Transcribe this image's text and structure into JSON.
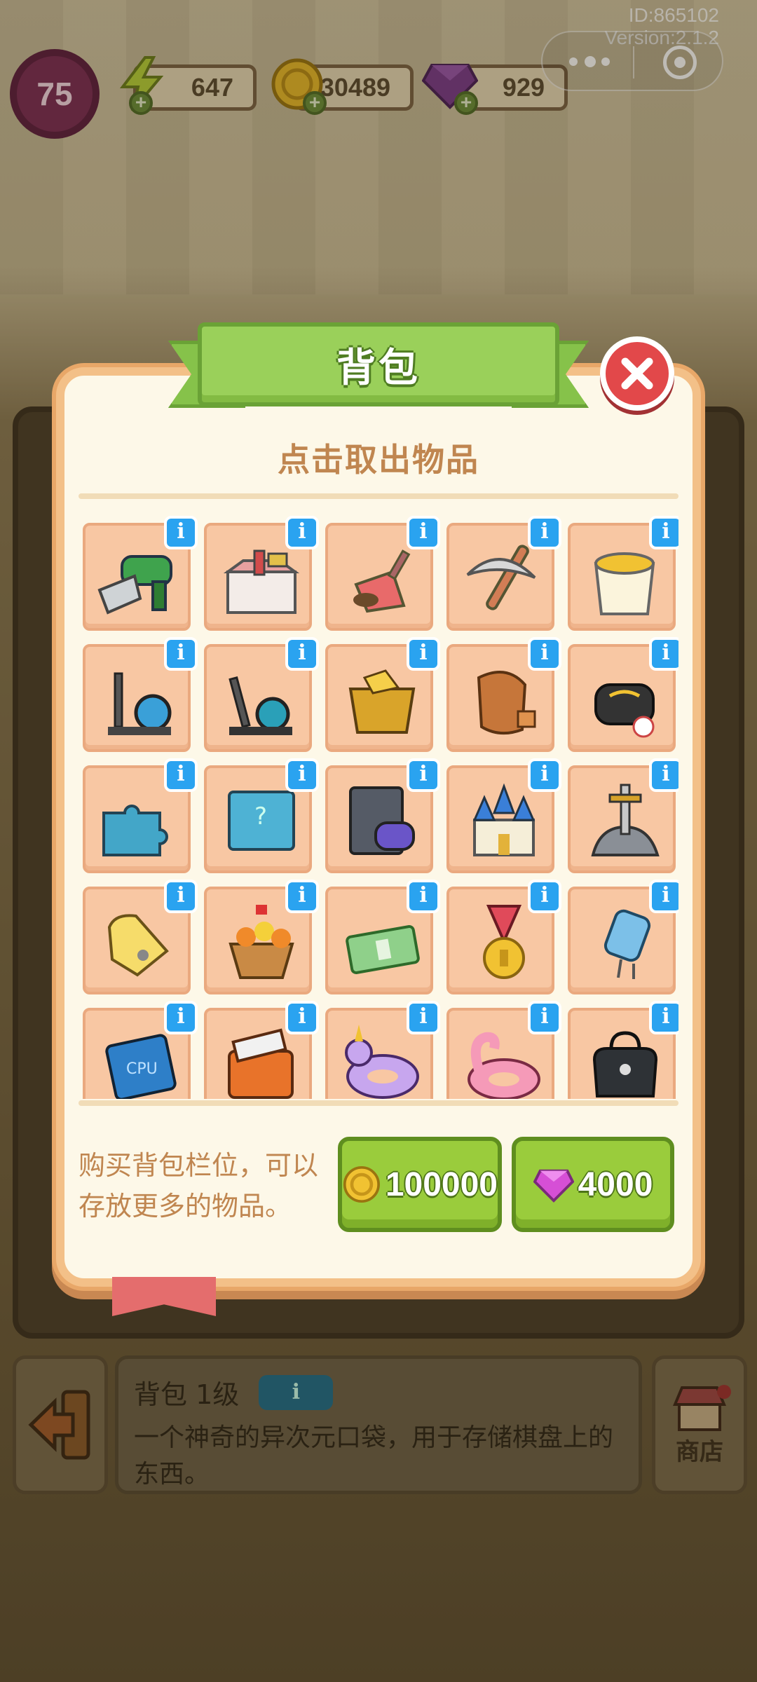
{
  "system": {
    "id_text": "ID:865102",
    "version_text": "Version:2.1.2"
  },
  "hud": {
    "level": "75",
    "energy": "647",
    "coins": "30489",
    "gems": "929"
  },
  "modal": {
    "title": "背包",
    "subtitle": "点击取出物品",
    "items": [
      {
        "name": "saw-drill-icon"
      },
      {
        "name": "toolbox-icon"
      },
      {
        "name": "trowel-icon"
      },
      {
        "name": "pickaxe-icon"
      },
      {
        "name": "paint-bucket-icon"
      },
      {
        "name": "elliptical-machine-icon"
      },
      {
        "name": "exercise-bike-icon"
      },
      {
        "name": "gold-ore-crate-icon"
      },
      {
        "name": "copper-ore-icon"
      },
      {
        "name": "smart-watch-icon"
      },
      {
        "name": "puzzle-pieces-icon"
      },
      {
        "name": "puzzle-board-icon"
      },
      {
        "name": "ds-console-icon"
      },
      {
        "name": "castle-icon"
      },
      {
        "name": "sword-in-stone-icon"
      },
      {
        "name": "paper-cutting-icon"
      },
      {
        "name": "flower-basket-icon"
      },
      {
        "name": "cash-stack-icon"
      },
      {
        "name": "gold-medal-icon"
      },
      {
        "name": "capacitor-icon"
      },
      {
        "name": "cpu-chip-icon"
      },
      {
        "name": "cooler-box-icon"
      },
      {
        "name": "unicorn-float-icon"
      },
      {
        "name": "flamingo-float-icon"
      },
      {
        "name": "black-bag-icon"
      }
    ],
    "info_glyph": "i",
    "buy_text": "购买背包栏位，可以存放更多的物品。",
    "buy_coins_price": "100000",
    "buy_gems_price": "4000"
  },
  "bottom": {
    "item_title": "背包 1级",
    "item_info_glyph": "i",
    "item_desc": "一个神奇的异次元口袋，用于存储棋盘上的东西。",
    "shop_label": "商店"
  },
  "colors": {
    "modal_bg": "#fdf8e8",
    "modal_border": "#f3c088",
    "title_green": "#9ad05a",
    "button_green": "#9acc3c",
    "close_red": "#e2484a",
    "info_blue": "#2aa3f0",
    "cell_peach": "#f8c7a3",
    "text_brown": "#c08650"
  }
}
